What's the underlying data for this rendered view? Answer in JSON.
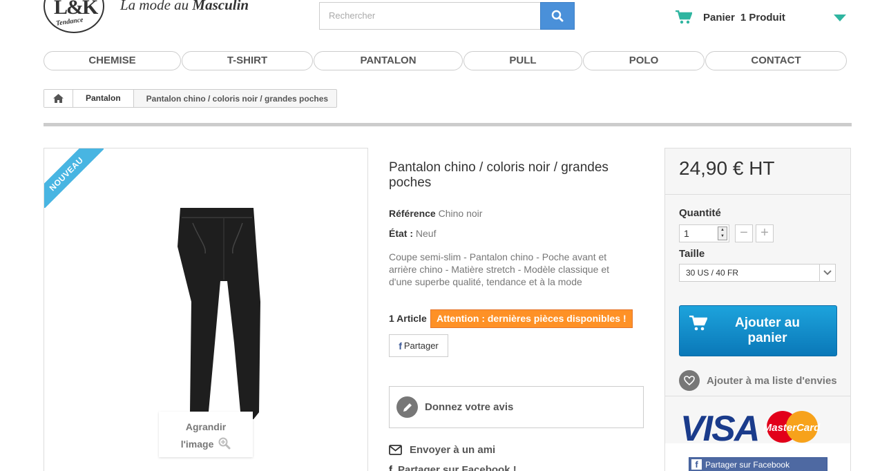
{
  "header": {
    "logo_mark": "L&K",
    "logo_tag": "Tendance",
    "tagline_prefix": "La mode au ",
    "tagline_bold": "Masculin",
    "search_placeholder": "Rechercher",
    "cart_label": "Panier",
    "cart_count": "1 Produit"
  },
  "nav": {
    "items": [
      "CHEMISE",
      "T-SHIRT",
      "PANTALON",
      "PULL",
      "POLO",
      "CONTACT"
    ]
  },
  "breadcrumb": {
    "category": "Pantalon",
    "current": "Pantalon chino / coloris noir / grandes poches"
  },
  "product": {
    "badge": "NOUVEAU",
    "zoom_label_1": "Agrandir",
    "zoom_label_2": "l'image",
    "title": "Pantalon chino / coloris noir / grandes poches",
    "reference_label": "Référence",
    "reference_value": "Chino noir",
    "state_label": "État :",
    "state_value": "Neuf",
    "description": "Coupe semi-slim - Pantalon chino - Poche avant et arrière chino - Matière stretch - Modèle classique et d'une superbe qualité, tendance et à la mode",
    "stock": "1 Article",
    "warning": "Attention : dernières pièces disponibles !",
    "share_label": "Partager",
    "review_label": "Donnez votre avis",
    "send_friend": "Envoyer à un ami",
    "fb_share": "Partager sur Facebook !"
  },
  "buy": {
    "price": "24,90 € HT",
    "qty_label": "Quantité",
    "qty_value": "1",
    "size_label": "Taille",
    "size_value": "30 US / 40 FR",
    "add_to_cart": "Ajouter au panier",
    "wishlist": "Ajouter à ma liste d'envies",
    "card_visa": "VISA",
    "card_mastercard": "MasterCard",
    "fb_widget": "Partager sur Facebook"
  },
  "colors": {
    "accent_blue": "#4a90d9",
    "cart_green": "#2fb5a0",
    "ribbon_blue": "#48b5e2",
    "warning_orange": "#fe9126",
    "add_to_cart_blue": "#1a9ad6"
  }
}
